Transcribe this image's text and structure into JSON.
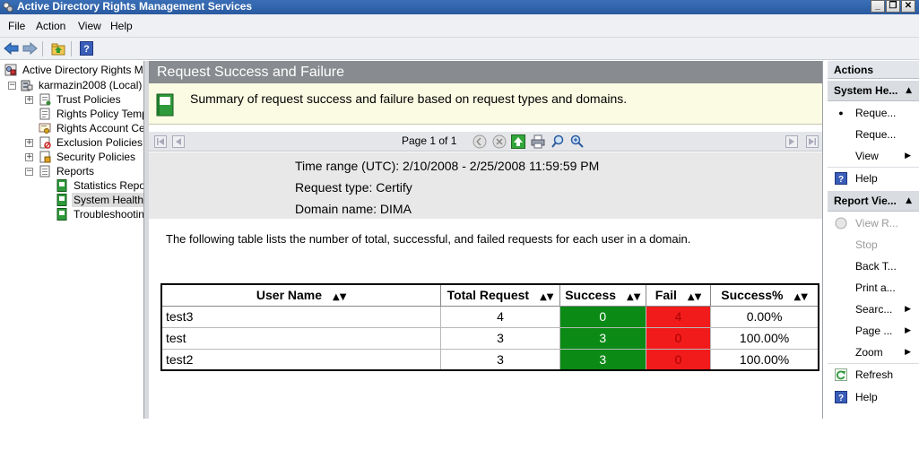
{
  "window": {
    "title": "Active Directory Rights Management Services",
    "minimize": "_",
    "restore": "❐",
    "close": "✕"
  },
  "menu": [
    "File",
    "Action",
    "View",
    "Help"
  ],
  "tree": {
    "root": "Active Directory Rights Management Services",
    "server": "karmazin2008 (Local)",
    "items": [
      {
        "label": "Trust Policies"
      },
      {
        "label": "Rights Policy Templates"
      },
      {
        "label": "Rights Account Certificate Policies"
      },
      {
        "label": "Exclusion Policies"
      },
      {
        "label": "Security Policies"
      },
      {
        "label": "Reports"
      }
    ],
    "reports": [
      {
        "label": "Statistics Reports"
      },
      {
        "label": "System Health"
      },
      {
        "label": "Troubleshooting"
      }
    ]
  },
  "report": {
    "title": "Request Success and Failure",
    "summary": "Summary of request success and failure based on request types and domains.",
    "page_info": "Page 1 of 1",
    "time_range": "Time range (UTC): 2/10/2008 - 2/25/2008 11:59:59 PM",
    "request_type": "Request type: Certify",
    "domain": "Domain name: DIMA",
    "description": "The following table lists the number of total, successful, and failed requests for each user in a domain.",
    "columns": [
      "User Name",
      "Total Request",
      "Success",
      "Fail",
      "Success%"
    ],
    "rows": [
      {
        "user": "test3",
        "total": "4",
        "success": "0",
        "fail": "4",
        "pct": "0.00%"
      },
      {
        "user": "test",
        "total": "3",
        "success": "3",
        "fail": "0",
        "pct": "100.00%"
      },
      {
        "user": "test2",
        "total": "3",
        "success": "3",
        "fail": "0",
        "pct": "100.00%"
      }
    ]
  },
  "actions": {
    "title": "Actions",
    "section1": "System He...",
    "section1_items": [
      {
        "label": "Reque...",
        "bullet": true
      },
      {
        "label": "Reque..."
      },
      {
        "label": "View",
        "submenu": true
      },
      {
        "label": "Help",
        "icon": "help-icon"
      }
    ],
    "section2": "Report Vie...",
    "section2_items": [
      {
        "label": "View R...",
        "disabled": true,
        "icon": "view-report-icon"
      },
      {
        "label": "Stop",
        "disabled": true
      },
      {
        "label": "Back T..."
      },
      {
        "label": "Print a..."
      },
      {
        "label": "Searc...",
        "submenu": true
      },
      {
        "label": "Page ...",
        "submenu": true
      },
      {
        "label": "Zoom",
        "submenu": true
      },
      {
        "label": "Refresh",
        "icon": "refresh-icon"
      },
      {
        "label": "Help",
        "icon": "help-icon"
      }
    ]
  },
  "colors": {
    "success": "#0b8a16",
    "fail": "#f21b1b",
    "title_bar": "#2a5aa0",
    "report_header": "#888b8f"
  }
}
